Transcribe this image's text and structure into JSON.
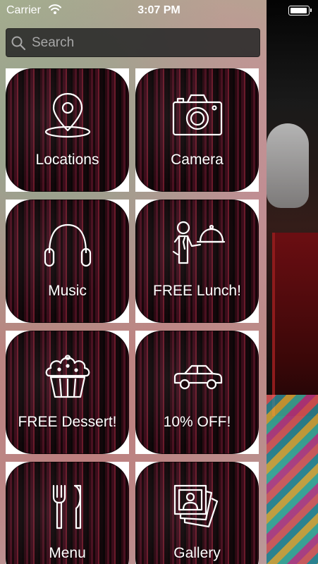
{
  "status_bar": {
    "carrier": "Carrier",
    "time": "3:07 PM",
    "battery_level": 1.0
  },
  "search": {
    "placeholder": "Search",
    "value": ""
  },
  "menu": {
    "items": [
      {
        "label": "Locations",
        "icon": "location-pin-icon"
      },
      {
        "label": "Camera",
        "icon": "camera-icon"
      },
      {
        "label": "Music",
        "icon": "headphones-icon"
      },
      {
        "label": "FREE Lunch!",
        "icon": "waiter-icon"
      },
      {
        "label": "FREE Dessert!",
        "icon": "cupcake-icon"
      },
      {
        "label": "10% OFF!",
        "icon": "car-icon"
      },
      {
        "label": "Menu",
        "icon": "fork-knife-icon"
      },
      {
        "label": "Gallery",
        "icon": "photo-gallery-icon"
      }
    ]
  },
  "colors": {
    "tile_wood_dark": "#1a070b",
    "tile_wood_red": "#4a1020",
    "icon_stroke": "#ffffff",
    "search_background": "#282828"
  }
}
